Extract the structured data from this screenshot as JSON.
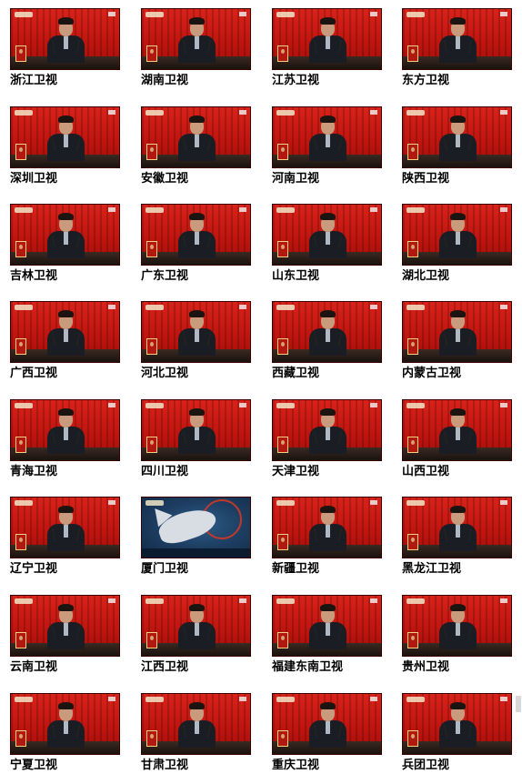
{
  "channels": [
    {
      "name": "浙江卫视",
      "scene": "speech"
    },
    {
      "name": "湖南卫视",
      "scene": "speech"
    },
    {
      "name": "江苏卫视",
      "scene": "speech"
    },
    {
      "name": "东方卫视",
      "scene": "speech"
    },
    {
      "name": "深圳卫视",
      "scene": "speech"
    },
    {
      "name": "安徽卫视",
      "scene": "speech"
    },
    {
      "name": "河南卫视",
      "scene": "speech"
    },
    {
      "name": "陕西卫视",
      "scene": "speech"
    },
    {
      "name": "吉林卫视",
      "scene": "speech"
    },
    {
      "name": "广东卫视",
      "scene": "speech"
    },
    {
      "name": "山东卫视",
      "scene": "speech"
    },
    {
      "name": "湖北卫视",
      "scene": "speech"
    },
    {
      "name": "广西卫视",
      "scene": "speech"
    },
    {
      "name": "河北卫视",
      "scene": "speech"
    },
    {
      "name": "西藏卫视",
      "scene": "speech"
    },
    {
      "name": "内蒙古卫视",
      "scene": "speech"
    },
    {
      "name": "青海卫视",
      "scene": "speech"
    },
    {
      "name": "四川卫视",
      "scene": "speech"
    },
    {
      "name": "天津卫视",
      "scene": "speech"
    },
    {
      "name": "山西卫视",
      "scene": "speech"
    },
    {
      "name": "辽宁卫视",
      "scene": "speech"
    },
    {
      "name": "厦门卫视",
      "scene": "animation"
    },
    {
      "name": "新疆卫视",
      "scene": "speech"
    },
    {
      "name": "黑龙江卫视",
      "scene": "speech"
    },
    {
      "name": "云南卫视",
      "scene": "speech"
    },
    {
      "name": "江西卫视",
      "scene": "speech"
    },
    {
      "name": "福建东南卫视",
      "scene": "speech"
    },
    {
      "name": "贵州卫视",
      "scene": "speech"
    },
    {
      "name": "宁夏卫视",
      "scene": "speech"
    },
    {
      "name": "甘肃卫视",
      "scene": "speech"
    },
    {
      "name": "重庆卫视",
      "scene": "speech"
    },
    {
      "name": "兵团卫视",
      "scene": "speech"
    }
  ]
}
